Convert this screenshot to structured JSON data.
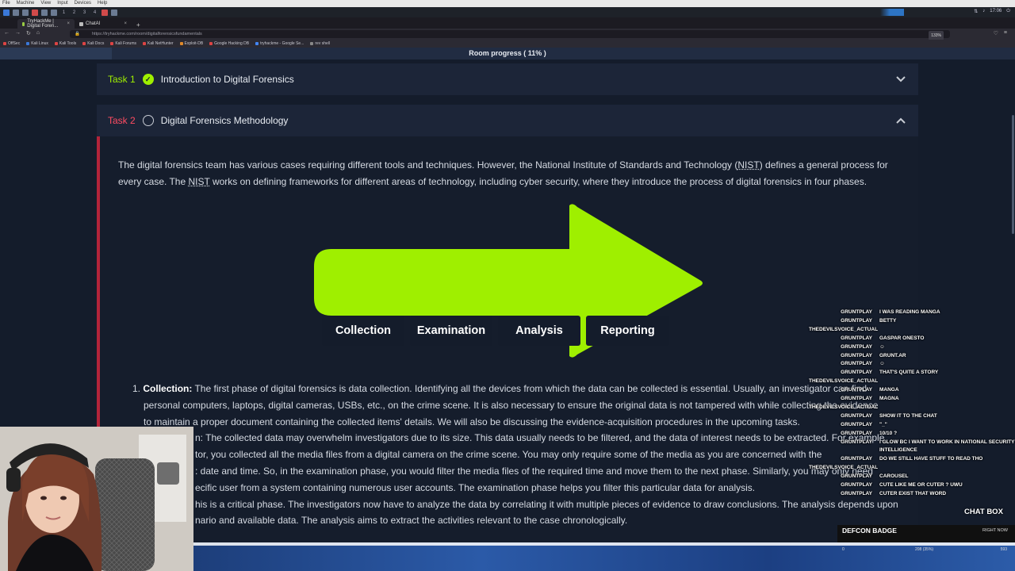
{
  "os_menu": [
    "File",
    "Machine",
    "View",
    "Input",
    "Devices",
    "Help"
  ],
  "os_panel": {
    "workspaces": [
      "1",
      "2",
      "3",
      "4"
    ],
    "clock": "17:06"
  },
  "browser": {
    "tabs": [
      {
        "label": "TryHackMe | Digital Foren...",
        "active": true
      },
      {
        "label": "ChatAI",
        "active": false
      }
    ],
    "url": "https://tryhackme.com/room/digitalforensicsfundamentals",
    "zoom": "133%",
    "bookmarks": [
      "OffSec",
      "Kali Linux",
      "Kali Tools",
      "Kali Docs",
      "Kali Forums",
      "Kali NetHunter",
      "Exploit-DB",
      "Google Hacking DB",
      "tryhackme - Google Se...",
      "rev shell"
    ]
  },
  "room_progress": {
    "label": "Room progress ( 11% )",
    "percent": 11
  },
  "task1": {
    "label": "Task 1",
    "title": "Introduction to Digital Forensics",
    "completed": true
  },
  "task2": {
    "label": "Task 2",
    "title": "Digital Forensics Methodology",
    "completed": false,
    "intro_part1": "The digital forensics team has various cases requiring different tools and techniques. However, the National Institute of Standards and Technology (",
    "intro_nist1": "NIST",
    "intro_part2": ") defines a general process for every case. The ",
    "intro_nist2": "NIST",
    "intro_part3": " works on defining frameworks for different areas of technology, including cyber security, where they introduce the process of digital forensics in four phases.",
    "phases": [
      "Collection",
      "Examination",
      "Analysis",
      "Reporting"
    ],
    "list": {
      "collection_num": "1.",
      "collection_term": "Collection:",
      "collection_l1": " The first phase of digital forensics is data collection. Identifying all the devices from which the data can be collected is essential. Usually, an investigator can find",
      "collection_l2": "personal computers, laptops, digital cameras, USBs, etc., on the crime scene. It is also necessary to ensure the original data is not tampered with while collecting the evidence",
      "collection_l3": "to maintain a proper document containing the collected items' details. We will also be discussing the evidence-acquisition procedures in the upcoming tasks.",
      "examination_l1": "n: The collected data may overwhelm investigators due to its size. This data usually needs to be filtered, and the data of interest needs to be extracted. For example",
      "examination_l2": "tor, you collected all the media files from a digital camera on the crime scene. You may only require some of the media as you are concerned with the",
      "examination_l3": ": date and time. So, in the examination phase, you would filter the media files of the required time and move them to the next phase. Similarly, you may only need",
      "examination_l4": "ecific user from a system containing numerous user accounts. The examination phase helps you filter this particular data for analysis.",
      "analysis_l1": "his is a critical phase. The investigators now have to analyze the data by correlating it with multiple pieces of evidence to draw conclusions. The analysis depends upon",
      "analysis_l2": "nario and available data. The analysis aims to extract the activities relevant to the case chronologically."
    }
  },
  "chat": {
    "messages": [
      {
        "user": "GRUNTPLAY",
        "text": "I WAS READING MANGA"
      },
      {
        "user": "GRUNTPLAY",
        "text": "BETTY"
      },
      {
        "user": "THEDEVILSVOICE_ACTUAL",
        "text": ""
      },
      {
        "user": "GRUNTPLAY",
        "text": "GASPAR ONESTO"
      },
      {
        "user": "GRUNTPLAY",
        "text": "☺"
      },
      {
        "user": "GRUNTPLAY",
        "text": "GRUNT.AR"
      },
      {
        "user": "GRUNTPLAY",
        "text": "☺"
      },
      {
        "user": "GRUNTPLAY",
        "text": "THAT'S QUITE A STORY"
      },
      {
        "user": "THEDEVILSVOICE_ACTUAL",
        "text": ""
      },
      {
        "user": "GRUNTPLAY",
        "text": "MANGA"
      },
      {
        "user": "GRUNTPLAY",
        "text": "MAGNA"
      },
      {
        "user": "THEDEVILSVOICE_ACTUAL",
        "text": ""
      },
      {
        "user": "GRUNTPLAY",
        "text": "SHOW IT TO THE CHAT"
      },
      {
        "user": "GRUNTPLAY",
        "text": "\"_\""
      },
      {
        "user": "GRUNTPLAY",
        "text": "10/10 ?"
      },
      {
        "user": "GRUNTPLAY",
        "text": "I GLOW BC I WANT TO WORK IN NATIONAL SECURITY"
      },
      {
        "user": "",
        "text": "INTELLIGENCE"
      },
      {
        "user": "GRUNTPLAY",
        "text": "DO WE STILL HAVE STUFF TO READ THO"
      },
      {
        "user": "THEDEVILSVOICE_ACTUAL",
        "text": ""
      },
      {
        "user": "GRUNTPLAY",
        "text": "CAROUSEL"
      },
      {
        "user": "GRUNTPLAY",
        "text": "CUTE LIKE ME OR CUTER ? UWU"
      },
      {
        "user": "GRUNTPLAY",
        "text": "CUTER EXIST THAT WORD"
      }
    ],
    "box_label": "CHAT BOX",
    "badge_label": "DEFCON BADGE",
    "right_now": "RIGHT NOW",
    "status_left": "0",
    "status_mid": "208 (35%)",
    "status_right": "593"
  },
  "colors": {
    "accent_green": "#9fef00",
    "accent_red": "#ff4c62",
    "page_bg": "#141c2b",
    "panel_bg": "#1c2538"
  }
}
